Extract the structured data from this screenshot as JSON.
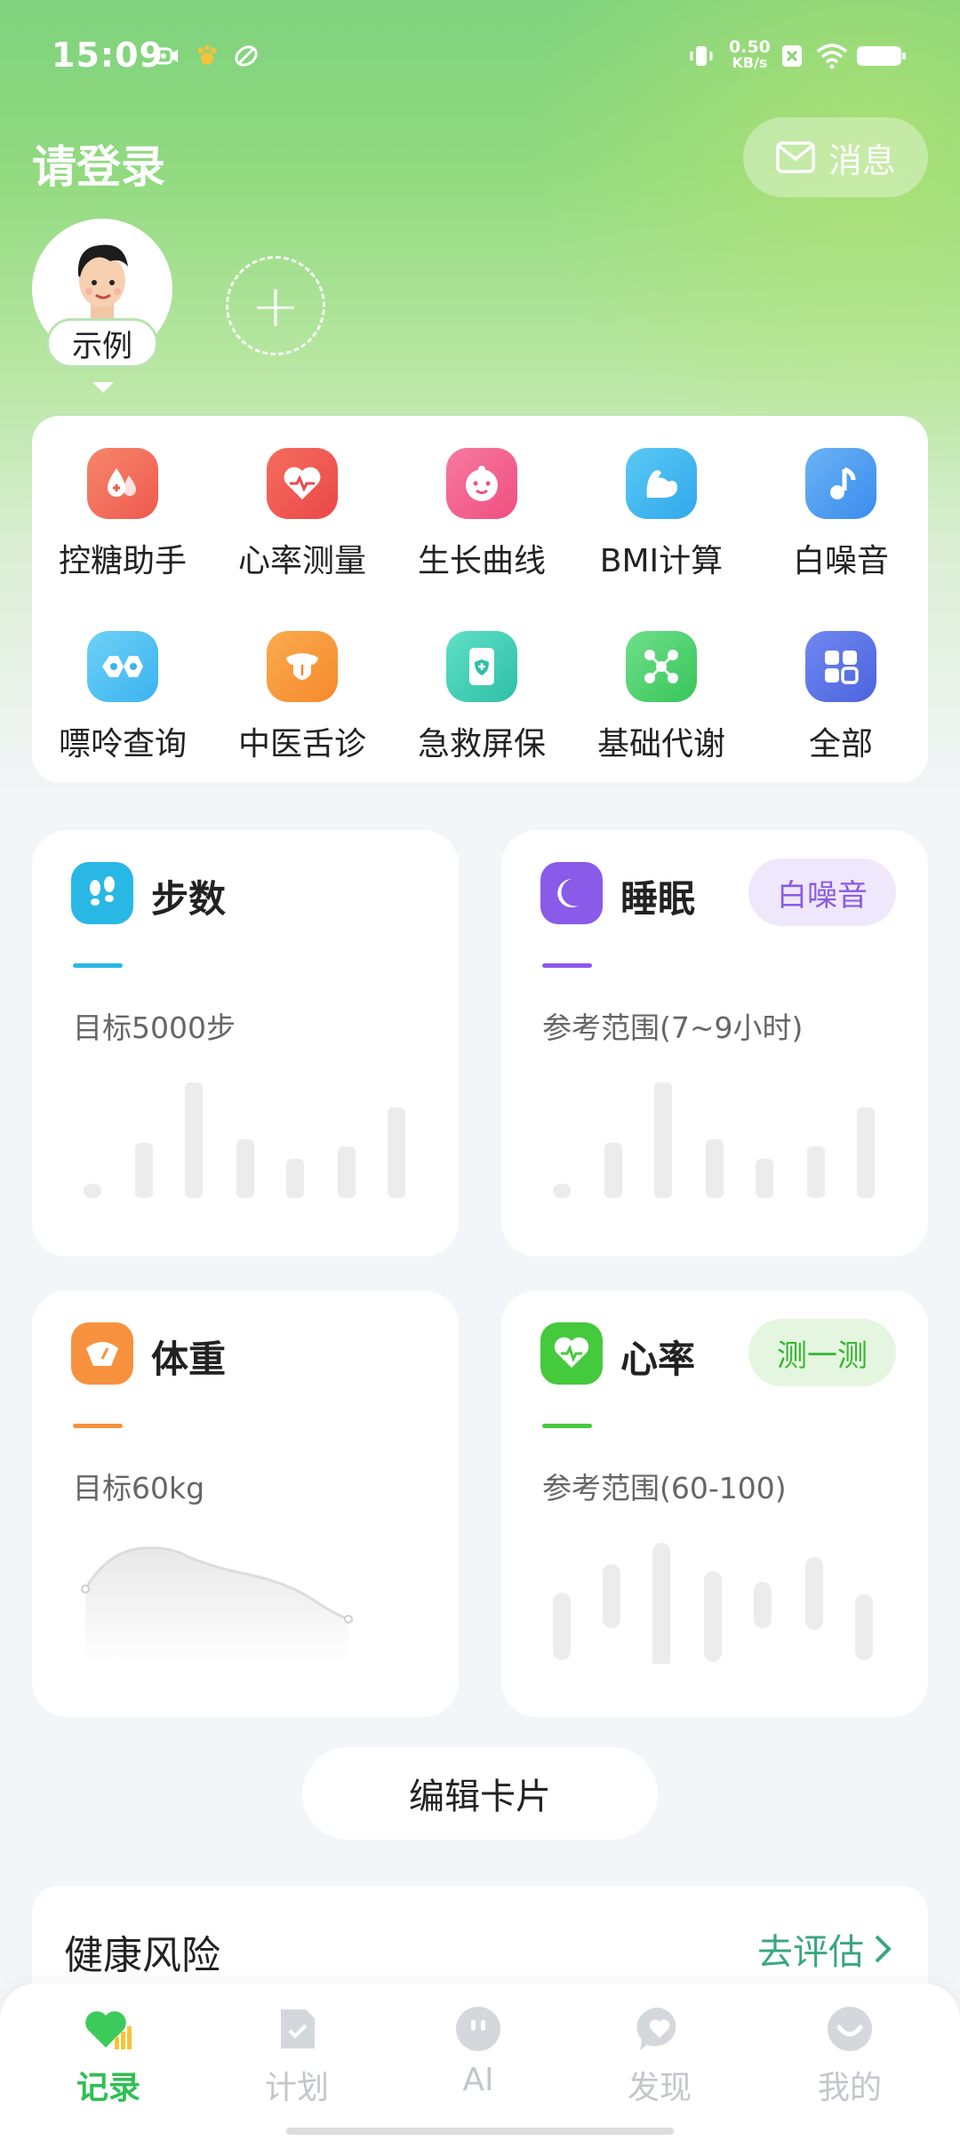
{
  "status_bar": {
    "time": "15:09",
    "net_speed_value": "0.50",
    "net_speed_unit": "KB/s",
    "icons": [
      "camera-icon",
      "paw-icon",
      "leaf-icon",
      "vibrate-icon",
      "sim-x-icon",
      "wifi-icon",
      "battery-icon"
    ]
  },
  "header": {
    "title": "请登录",
    "message_label": "消息"
  },
  "profile": {
    "avatar_label": "示例",
    "add_icon": "plus-icon"
  },
  "tools": {
    "items": [
      {
        "label": "控糖助手",
        "icon": "blood-drop-icon",
        "color": "#f2725e"
      },
      {
        "label": "心率测量",
        "icon": "heart-pulse-icon",
        "color": "#f0584f"
      },
      {
        "label": "生长曲线",
        "icon": "baby-face-icon",
        "color": "#f45e8b"
      },
      {
        "label": "BMI计算",
        "icon": "muscle-icon",
        "color": "#3fb7f0"
      },
      {
        "label": "白噪音",
        "icon": "music-note-icon",
        "color": "#4a9bf0"
      },
      {
        "label": "嘌呤查询",
        "icon": "molecule-icon",
        "color": "#4cc0f4"
      },
      {
        "label": "中医舌诊",
        "icon": "tongue-icon",
        "color": "#f7953a"
      },
      {
        "label": "急救屏保",
        "icon": "phone-shield-icon",
        "color": "#3fcfb7"
      },
      {
        "label": "基础代谢",
        "icon": "network-icon",
        "color": "#4fcf6e"
      },
      {
        "label": "全部",
        "icon": "grid-icon",
        "color": "#5a74e6"
      }
    ]
  },
  "cards": {
    "steps": {
      "title": "步数",
      "subtitle": "目标5000步",
      "color": "#29b7e6",
      "icon": "footprints-icon"
    },
    "sleep": {
      "title": "睡眠",
      "subtitle": "参考范围(7~9小时)",
      "pill": "白噪音",
      "color": "#8a5ae8",
      "icon": "moon-icon"
    },
    "weight": {
      "title": "体重",
      "subtitle": "目标60kg",
      "color": "#f7913e",
      "icon": "scale-icon"
    },
    "heart": {
      "title": "心率",
      "subtitle": "参考范围(60-100)",
      "pill": "测一测",
      "color": "#45c93d",
      "icon": "heart-icon"
    }
  },
  "edit_button": "编辑卡片",
  "health_risk": {
    "title": "健康风险",
    "link": "去评估"
  },
  "tabbar": {
    "items": [
      {
        "label": "记录",
        "icon": "heart-chart-icon",
        "active": true
      },
      {
        "label": "计划",
        "icon": "checklist-icon",
        "active": false
      },
      {
        "label": "AI",
        "icon": "robot-face-icon",
        "active": false
      },
      {
        "label": "发现",
        "icon": "chat-heart-icon",
        "active": false
      },
      {
        "label": "我的",
        "icon": "smile-icon",
        "active": false
      }
    ]
  }
}
